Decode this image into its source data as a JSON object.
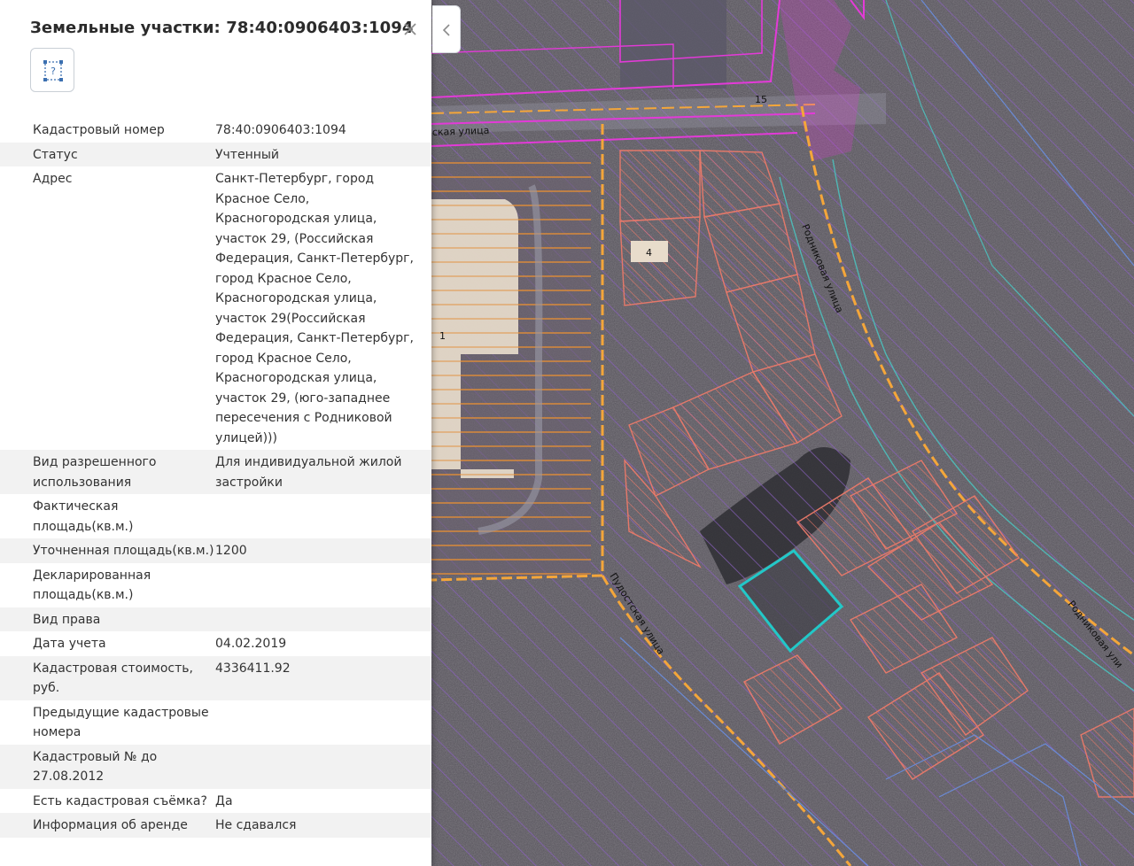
{
  "panel": {
    "title": "Земельные участки: 78:40:0906403:1094",
    "close_icon": "close-icon",
    "geometry_icon": "parcel-geometry-icon",
    "collapse_icon": "chevron-left-icon",
    "properties": [
      {
        "key": "Кадастровый номер",
        "value": "78:40:0906403:1094"
      },
      {
        "key": "Статус",
        "value": "Учтенный"
      },
      {
        "key": "Адрес",
        "value": "Санкт-Петербург, город Красное Село, Красногородская улица, участок 29, (Российская Федерация, Санкт-Петербург, город Красное Село, Красногородская улица, участок 29(Российская Федерация, Санкт-Петербург, город Красное Село, Красногородская улица, участок 29, (юго-западнее пересечения с Родниковой улицей)))"
      },
      {
        "key": "Вид разрешенного использования",
        "value": "Для индивидуальной жилой застройки"
      },
      {
        "key": "Фактическая площадь(кв.м.)",
        "value": ""
      },
      {
        "key": "Уточненная площадь(кв.м.)",
        "value": "1200"
      },
      {
        "key": "Декларированная площадь(кв.м.)",
        "value": ""
      },
      {
        "key": "Вид права",
        "value": ""
      },
      {
        "key": "Дата учета",
        "value": "04.02.2019"
      },
      {
        "key": "Кадастровая стоимость, руб.",
        "value": "4336411.92"
      },
      {
        "key": "Предыдущие кадастровые номера",
        "value": ""
      },
      {
        "key": "Кадастровый № до 27.08.2012",
        "value": ""
      },
      {
        "key": "Есть кадастровая съёмка?",
        "value": "Да"
      },
      {
        "key": "Информация об аренде",
        "value": "Не сдавался"
      }
    ]
  },
  "map": {
    "street_labels": [
      "ская улица",
      "Родниковая улица",
      "Пудостская улица",
      "Родниковая ули"
    ],
    "parcel_labels": [
      "4",
      "1",
      "15"
    ],
    "colors": {
      "highlight": "#22c8c8",
      "parcel_outline": "#ec7a6a",
      "hatch": "#8a5fc0",
      "road": "#f4a63a",
      "zone": "#e33ad8"
    }
  }
}
